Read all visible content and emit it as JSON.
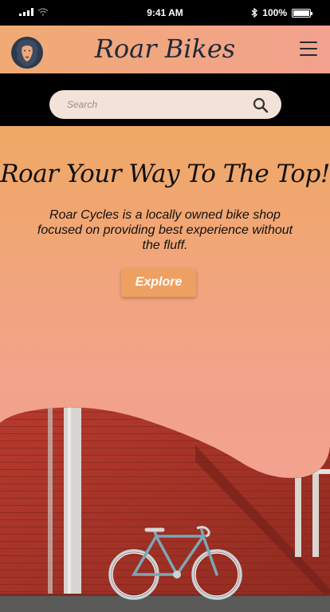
{
  "status": {
    "time": "9:41 AM",
    "battery": "100%",
    "battery_level": 1.0
  },
  "header": {
    "brand": "Roar Bikes",
    "logo_icon": "lion-icon",
    "menu_icon": "hamburger-menu-icon"
  },
  "search": {
    "placeholder": "Search",
    "icon": "search-icon"
  },
  "hero": {
    "title": "Roar Your Way To The Top!",
    "description": "Roar Cycles is a locally owned  bike shop focused on providing best experience without the fluff.",
    "cta": "Explore"
  },
  "colors": {
    "accent": "#eea062",
    "header_start": "#f1aa74",
    "header_end": "#f2a28e",
    "search_bg": "#f3e2d8",
    "wall": "#a8362b"
  }
}
